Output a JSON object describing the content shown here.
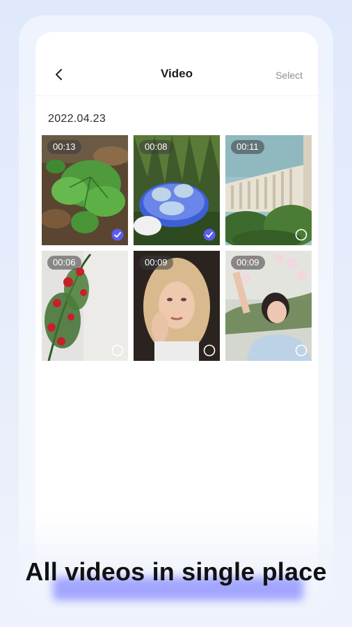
{
  "header": {
    "title": "Video",
    "select_label": "Select"
  },
  "date_label": "2022.04.23",
  "videos": [
    {
      "duration": "00:13",
      "subject": "green leaves plant",
      "selected": true
    },
    {
      "duration": "00:08",
      "subject": "glasses on blue tray in grass",
      "selected": true
    },
    {
      "duration": "00:11",
      "subject": "classical building with columns",
      "selected": false
    },
    {
      "duration": "00:06",
      "subject": "red roses on white wall",
      "selected": false
    },
    {
      "duration": "00:09",
      "subject": "blonde woman portrait",
      "selected": false
    },
    {
      "duration": "00:09",
      "subject": "woman with orchids",
      "selected": false
    }
  ],
  "headline": "All videos in single place",
  "colors": {
    "accent": "#5a5cf0",
    "highlight": "#6266ff",
    "background": "#e6edfb"
  }
}
